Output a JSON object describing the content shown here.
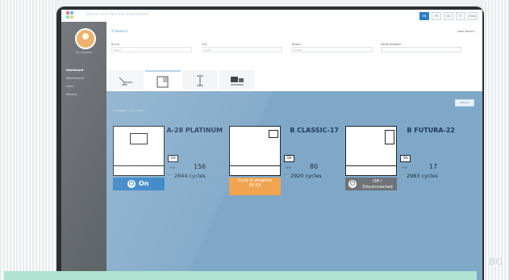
{
  "app": {
    "title": "Dental Unit Monitor",
    "subtitle": "Dashboard"
  },
  "topbar": {
    "buttons": [
      "EN",
      "FR",
      "DE",
      "IT",
      "Help"
    ]
  },
  "sidebar": {
    "user_name": "Dr. Laurent",
    "items": [
      "Dashboard",
      "Maintenance",
      "Users",
      "Reports"
    ]
  },
  "filters": {
    "search_label": "Search",
    "right_actions": "New Search",
    "fields": [
      {
        "label": "Brand",
        "placeholder": "Select"
      },
      {
        "label": "City",
        "placeholder": "Select"
      },
      {
        "label": "Brand",
        "placeholder": "Select"
      },
      {
        "label": "Serial Number",
        "placeholder": ""
      }
    ]
  },
  "content": {
    "breadcrumb": "Autoclaves > All > Status",
    "button": "Refresh"
  },
  "devices": [
    {
      "name": "A-28 PLATINUM",
      "sn": "SN",
      "count": "156",
      "cycles": "2844 cycles",
      "status": "On",
      "status_type": "on"
    },
    {
      "name": "B CLASSIC-17",
      "sn": "SN",
      "count": "80",
      "cycles": "2920 cycles",
      "status": "Cycle in progress",
      "timer": "00:03",
      "status_type": "progress"
    },
    {
      "name": "B FUTURA-22",
      "sn": "SN",
      "count": "17",
      "cycles": "2983 cycles",
      "status": "Off / Disconnected",
      "status_type": "off"
    }
  ],
  "watermark": "BG",
  "colors": {
    "accent": "#2d7fc4",
    "progress": "#f0a450",
    "offline": "#6e7377",
    "content_bg": "#7fa8c8",
    "sidebar": "#4a4f55"
  }
}
